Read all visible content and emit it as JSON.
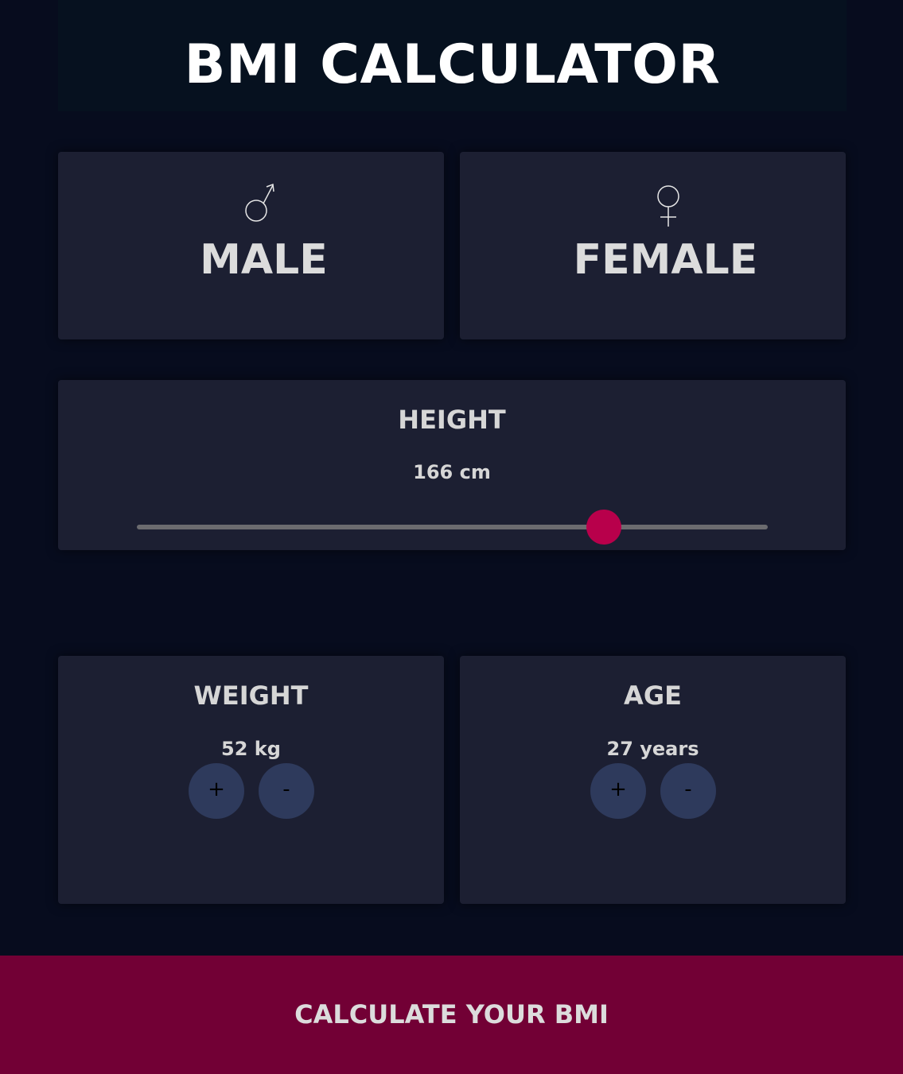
{
  "header": {
    "title": "BMI CALCULATOR"
  },
  "gender": {
    "male": {
      "label": "MALE",
      "icon": "male-symbol-icon"
    },
    "female": {
      "label": "FEMALE",
      "icon": "female-symbol-icon"
    }
  },
  "height": {
    "title": "HEIGHT",
    "value_text": "166 cm",
    "slider_fraction": 0.74
  },
  "weight": {
    "title": "WEIGHT",
    "value_text": "52 kg",
    "plus_label": "+",
    "minus_label": "-"
  },
  "age": {
    "title": "AGE",
    "value_text": "27 years",
    "plus_label": "+",
    "minus_label": "-"
  },
  "calculate": {
    "label": "CALCULATE YOUR BMI"
  },
  "colors": {
    "background": "#070c1e",
    "card": "#1c1f32",
    "accent": "#b8004b",
    "button_bar": "#720035",
    "round_button": "#2e3a5c"
  }
}
